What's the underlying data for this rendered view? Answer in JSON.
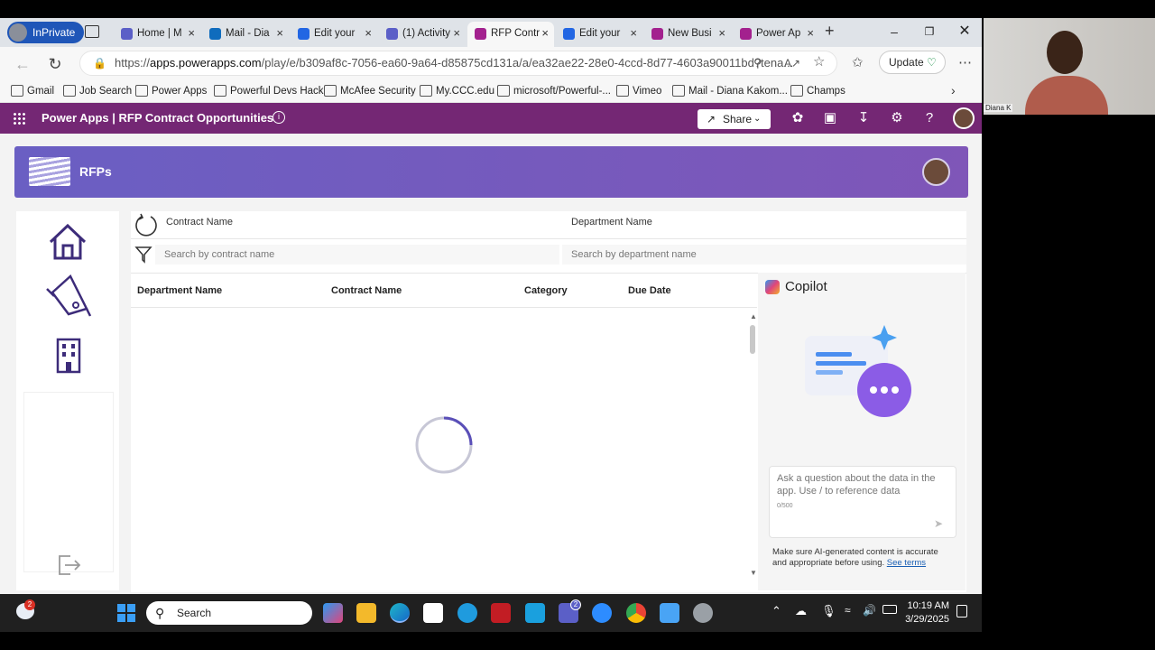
{
  "browser": {
    "inprivate_label": "InPrivate",
    "tabs": [
      {
        "label": "Home | M",
        "icon_color": "#5b5fc7"
      },
      {
        "label": "Mail - Dia",
        "icon_color": "#0f6cbd"
      },
      {
        "label": "Edit your",
        "icon_color": "#2266e3"
      },
      {
        "label": "(1) Activity",
        "icon_color": "#5b5fc7"
      },
      {
        "label": "RFP Contr",
        "icon_color": "#a3218e"
      },
      {
        "label": "Edit your",
        "icon_color": "#2266e3"
      },
      {
        "label": "New Busi",
        "icon_color": "#a3218e"
      },
      {
        "label": "Power Ap",
        "icon_color": "#a3218e"
      }
    ],
    "active_tab_index": 4,
    "url_prefix": "https://",
    "url_domain": "apps.powerapps.com",
    "url_rest": "/play/e/b309af8c-7056-ea60-9a64-d85875cd131a/a/ea32ae22-28e0-4ccd-8d77-4603a90011bd?tena...",
    "update_label": "Update",
    "bookmarks": [
      "Gmail",
      "Job Search",
      "Power Apps",
      "Powerful Devs Hack",
      "McAfee Security",
      "My.CCC.edu",
      "microsoft/Powerful-...",
      "Vimeo",
      "Mail - Diana Kakom...",
      "Champs"
    ]
  },
  "powerapps_header": {
    "title": "Power Apps  |  RFP Contract Opportunities",
    "share_label": "Share",
    "brand_color": "#742774"
  },
  "app": {
    "banner_title": "RFPs",
    "filters": {
      "contract_label": "Contract Name",
      "department_label": "Department Name",
      "contract_placeholder": "Search by contract name",
      "department_placeholder": "Search by department name"
    },
    "table_headers": [
      "Department Name",
      "Contract Name",
      "Category",
      "Due Date"
    ]
  },
  "copilot": {
    "title": "Copilot",
    "input_placeholder": "Ask a question about the data in the app. Use / to reference data",
    "char_count": "0/500",
    "disclaimer": "Make sure AI-generated content is accurate and appropriate before using.",
    "terms_link": "See terms"
  },
  "taskbar": {
    "search_label": "Search",
    "weather_badge": "2",
    "teams_badge": "2",
    "time": "10:19 AM",
    "date": "3/29/2025"
  },
  "webcam": {
    "name_tag": "Diana K"
  }
}
